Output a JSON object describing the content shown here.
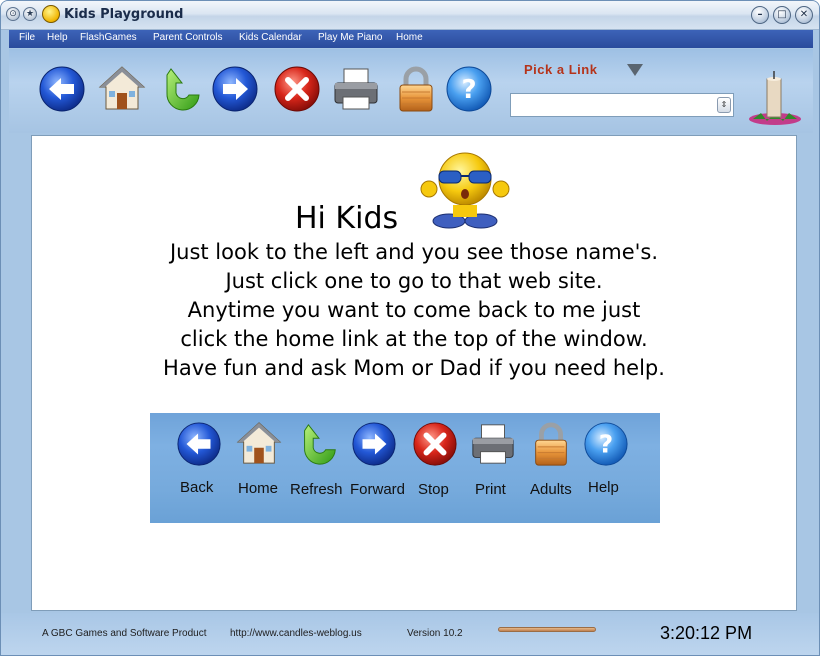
{
  "window": {
    "title": "Kids Playground",
    "controls": [
      "minimize-icon",
      "maximize-icon",
      "close-icon"
    ]
  },
  "menu": {
    "items": [
      "File",
      "Help",
      "FlashGames",
      "Parent Controls",
      "Kids Calendar",
      "Play Me Piano",
      "Home"
    ]
  },
  "toolbar": {
    "icons": [
      "back-icon",
      "home-icon",
      "refresh-icon",
      "forward-icon",
      "stop-icon",
      "print-icon",
      "lock-icon",
      "help-icon"
    ],
    "pick_label": "Pick a Link",
    "pick_value": ""
  },
  "content": {
    "greeting": "Hi Kids",
    "lines": [
      "Just look to the left and you see those name's.",
      "Just click one to go to that web site.",
      "Anytime you want to come back to me just",
      "click the home link at the top of the window.",
      "Have fun and ask Mom or Dad if you need help."
    ],
    "nav": [
      {
        "label": "Back",
        "icon": "back-icon"
      },
      {
        "label": "Home",
        "icon": "home-icon"
      },
      {
        "label": "Refresh",
        "icon": "refresh-icon"
      },
      {
        "label": "Forward",
        "icon": "forward-icon"
      },
      {
        "label": "Stop",
        "icon": "stop-icon"
      },
      {
        "label": "Print",
        "icon": "print-icon"
      },
      {
        "label": "Adults",
        "icon": "lock-icon"
      },
      {
        "label": "Help",
        "icon": "help-icon"
      }
    ]
  },
  "status": {
    "product": "A GBC Games and Software Product",
    "url": "http://www.candles-weblog.us",
    "version": "Version 10.2",
    "time": "3:20:12 PM"
  },
  "colors": {
    "menubar": "#2f53a6",
    "pick_label": "#b5331a",
    "panel": "#76aadc"
  }
}
